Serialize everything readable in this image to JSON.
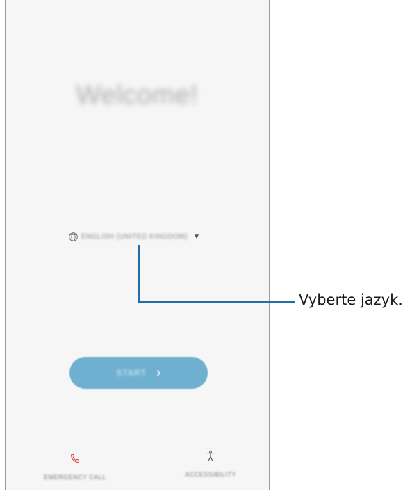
{
  "screen": {
    "title": "Welcome!",
    "language": {
      "icon": "globe-icon",
      "selected": "ENGLISH (UNITED KINGDOM)",
      "arrow": "▼"
    },
    "start_button": {
      "label": "START",
      "chevron": "›",
      "color": "#6fb0d0"
    },
    "bottom": {
      "emergency_call": {
        "icon": "phone-icon",
        "label": "EMERGENCY CALL"
      },
      "accessibility": {
        "icon": "accessibility-icon",
        "label": "ACCESSIBILITY"
      }
    }
  },
  "callout": {
    "text": "Vyberte jazyk.",
    "line_color": "#1f6fa8"
  }
}
